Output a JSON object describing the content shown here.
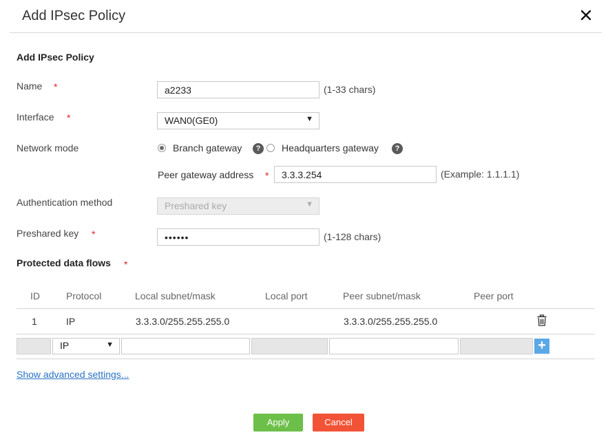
{
  "dialog": {
    "title": "Add IPsec Policy",
    "section_title": "Add IPsec Policy"
  },
  "form": {
    "required_mark": "*",
    "name": {
      "label": "Name",
      "value": "a2233",
      "hint": "(1-33 chars)"
    },
    "interface": {
      "label": "Interface",
      "value": "WAN0(GE0)"
    },
    "network_mode": {
      "label": "Network mode",
      "options": [
        {
          "label": "Branch gateway",
          "checked": true
        },
        {
          "label": "Headquarters gateway",
          "checked": false
        }
      ],
      "help_glyph": "?"
    },
    "peer_gateway": {
      "label": "Peer gateway address",
      "value": "3.3.3.254",
      "hint": "(Example: 1.1.1.1)"
    },
    "auth_method": {
      "label": "Authentication method",
      "value": "Preshared key"
    },
    "preshared_key": {
      "label": "Preshared key",
      "value": "••••••",
      "hint": "(1-128 chars)"
    }
  },
  "flows": {
    "title": "Protected data flows",
    "columns": [
      "ID",
      "Protocol",
      "Local subnet/mask",
      "Local port",
      "Peer subnet/mask",
      "Peer port"
    ],
    "rows": [
      {
        "id": "1",
        "protocol": "IP",
        "local_subnet": "3.3.3.0/255.255.255.0",
        "local_port": "",
        "peer_subnet": "3.3.3.0/255.255.255.0",
        "peer_port": ""
      }
    ],
    "new_row": {
      "protocol": "IP",
      "add_glyph": "+"
    }
  },
  "advanced_link": "Show advanced settings...",
  "buttons": {
    "apply": "Apply",
    "cancel": "Cancel"
  },
  "colors": {
    "apply": "#6cbf48",
    "cancel": "#f25336",
    "required": "#e02020",
    "link": "#2a72c4"
  },
  "icons": {
    "close": "close-icon",
    "trash": "trash-icon",
    "help": "help-icon",
    "dropdown": "chevron-down-icon",
    "add": "plus-icon"
  }
}
